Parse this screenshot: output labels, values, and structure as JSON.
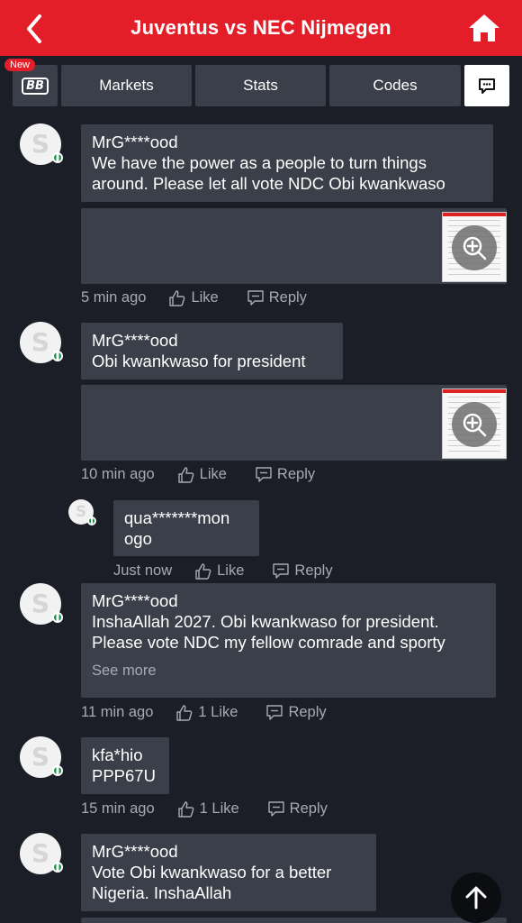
{
  "header": {
    "title": "Juventus vs NEC Nijmegen"
  },
  "badge": {
    "new": "New"
  },
  "tabs": {
    "bb": "BB",
    "markets": "Markets",
    "stats": "Stats",
    "codes": "Codes"
  },
  "comments": [
    {
      "user": "MrG****ood",
      "text": "We have the power as a people to turn things around. Please let all vote NDC Obi kwankwaso",
      "has_image": true,
      "time": "5 min ago",
      "like": "Like",
      "reply": "Reply"
    },
    {
      "user": "MrG****ood",
      "text": "Obi kwankwaso for president",
      "has_image": true,
      "time": "10 min ago",
      "like": "Like",
      "reply": "Reply"
    },
    {
      "user": "qua*******mon ogo",
      "text": "",
      "reply_to_previous": true,
      "time": "Just now",
      "like": "Like",
      "reply": "Reply"
    },
    {
      "user": "MrG****ood",
      "text": "InshaAllah 2027. Obi kwankwaso for president. Please vote NDC my fellow comrade and sporty",
      "see_more": "See more",
      "time": "11 min ago",
      "like": "1 Like",
      "reply": "Reply"
    },
    {
      "user": "kfa*hio",
      "text": "PPP67U",
      "time": "15 min ago",
      "like": "1 Like",
      "reply": "Reply"
    },
    {
      "user": "MrG****ood",
      "text": "Vote Obi kwankwaso for a better Nigeria. InshaAllah",
      "has_image": true
    }
  ],
  "colors": {
    "header_red": "#e41e28",
    "background": "#1b1e26",
    "bubble": "#3b3f49",
    "meta_text": "#a7aab3",
    "flag_green": "#18924a"
  },
  "icons": {
    "back": "chevron-left-icon",
    "home": "home-icon",
    "chat": "chat-bubble-icon",
    "like": "thumbs-up-icon",
    "reply": "reply-bubble-icon",
    "zoom": "zoom-in-icon",
    "scroll_top": "arrow-up-icon"
  }
}
